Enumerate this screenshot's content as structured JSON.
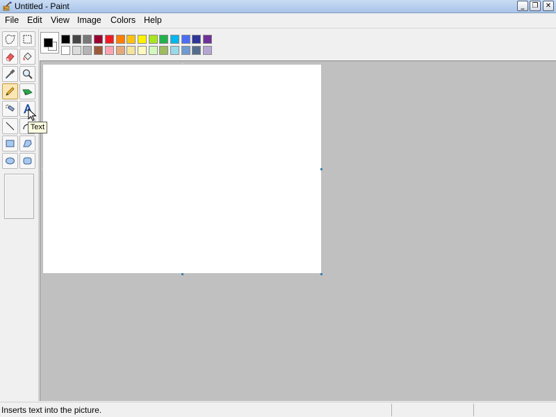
{
  "window": {
    "title": "Untitled - Paint",
    "minimize_glyph": "_",
    "maximize_glyph": "❐",
    "close_glyph": "✕"
  },
  "menu": {
    "items": [
      "File",
      "Edit",
      "View",
      "Image",
      "Colors",
      "Help"
    ]
  },
  "tools": [
    {
      "name": "free-form-select",
      "icon": "free-form-select-icon",
      "active": false
    },
    {
      "name": "select",
      "icon": "rect-select-icon",
      "active": false
    },
    {
      "name": "eraser",
      "icon": "eraser-icon",
      "active": false
    },
    {
      "name": "fill-with-color",
      "icon": "paint-bucket-icon",
      "active": false
    },
    {
      "name": "pick-color",
      "icon": "eyedropper-icon",
      "active": false
    },
    {
      "name": "magnifier",
      "icon": "magnifier-icon",
      "active": false
    },
    {
      "name": "pencil",
      "icon": "pencil-icon",
      "active": true
    },
    {
      "name": "brush",
      "icon": "brush-icon",
      "active": false
    },
    {
      "name": "airbrush",
      "icon": "airbrush-icon",
      "active": false
    },
    {
      "name": "text",
      "icon": "text-a-icon",
      "active": false
    },
    {
      "name": "line",
      "icon": "line-icon",
      "active": false
    },
    {
      "name": "curve",
      "icon": "curve-icon",
      "active": false
    },
    {
      "name": "rectangle",
      "icon": "rectangle-icon",
      "active": false
    },
    {
      "name": "polygon",
      "icon": "polygon-icon",
      "active": false
    },
    {
      "name": "ellipse",
      "icon": "ellipse-icon",
      "active": false
    },
    {
      "name": "rounded-rectangle",
      "icon": "rounded-rectangle-icon",
      "active": false
    }
  ],
  "palette": {
    "foreground": "#000000",
    "background": "#ffffff",
    "row1": [
      "#000000",
      "#464646",
      "#787878",
      "#990030",
      "#ed1c24",
      "#ff7e00",
      "#ffc20e",
      "#fff200",
      "#a8e61d",
      "#22b14c",
      "#00b7ef",
      "#4d6df3",
      "#2f3699",
      "#6f3198"
    ],
    "row2": [
      "#ffffff",
      "#dcdcdc",
      "#b4b4b4",
      "#9c5a3c",
      "#ffa3b1",
      "#e5aa7a",
      "#f5e49c",
      "#fff9bd",
      "#d3f9bc",
      "#9dbb61",
      "#99d9ea",
      "#709ad1",
      "#546d8e",
      "#b5a5d5"
    ]
  },
  "tooltip": {
    "text": "Text"
  },
  "status": {
    "text": "Inserts text into the picture."
  }
}
